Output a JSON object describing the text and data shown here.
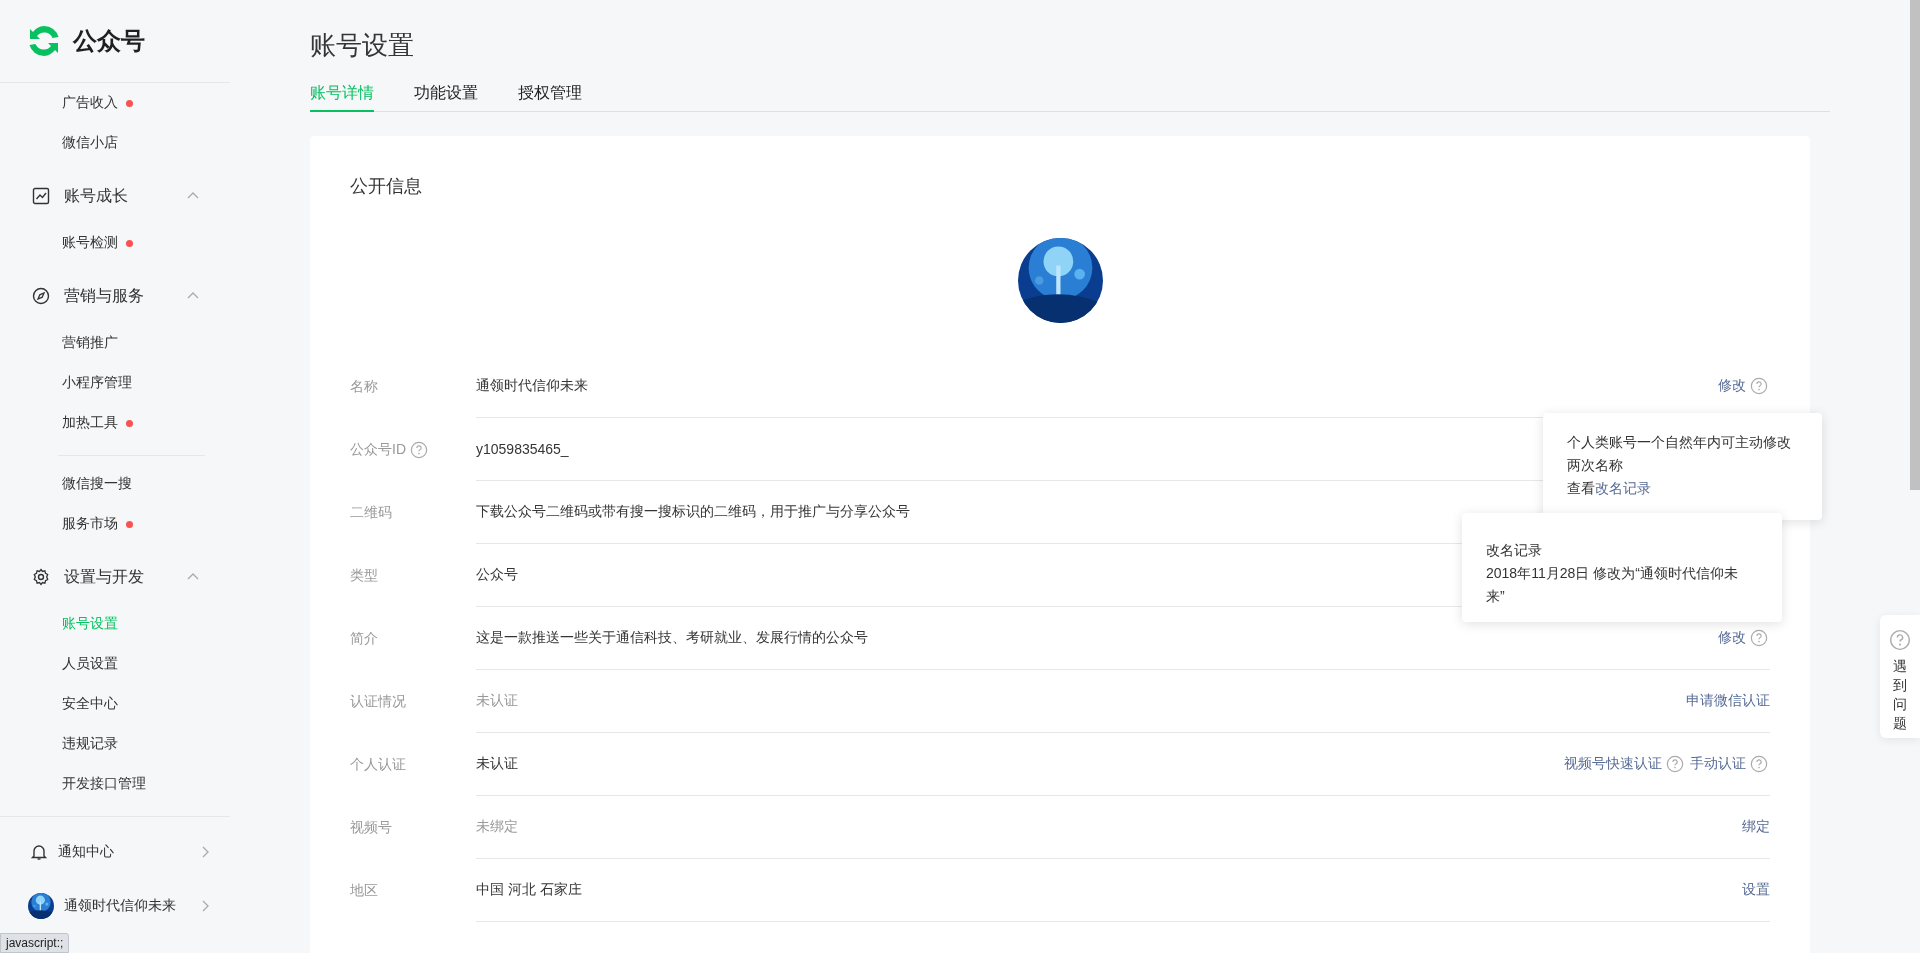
{
  "sidebar": {
    "logo_text": "公众号",
    "sections": [
      {
        "items": [
          {
            "kind": "link",
            "label": "广告收入",
            "badge": true,
            "selected": false
          },
          {
            "kind": "link",
            "label": "微信小店",
            "badge": false,
            "selected": false
          }
        ]
      },
      {
        "label": "账号成长",
        "expanded": true,
        "items": [
          {
            "kind": "link",
            "label": "账号检测",
            "badge": true,
            "selected": false
          }
        ]
      },
      {
        "label": "营销与服务",
        "expanded": true,
        "items": [
          {
            "kind": "link",
            "label": "营销推广",
            "badge": false,
            "selected": false
          },
          {
            "kind": "link",
            "label": "小程序管理",
            "badge": false,
            "selected": false
          },
          {
            "kind": "link",
            "label": "加热工具",
            "badge": true,
            "selected": false
          },
          {
            "kind": "separator"
          },
          {
            "kind": "link",
            "label": "微信搜一搜",
            "badge": false,
            "selected": false
          },
          {
            "kind": "link",
            "label": "服务市场",
            "badge": true,
            "selected": false
          }
        ]
      },
      {
        "label": "设置与开发",
        "expanded": true,
        "items": [
          {
            "kind": "link",
            "label": "账号设置",
            "badge": false,
            "selected": true
          },
          {
            "kind": "link",
            "label": "人员设置",
            "badge": false,
            "selected": false
          },
          {
            "kind": "link",
            "label": "安全中心",
            "badge": false,
            "selected": false
          },
          {
            "kind": "link",
            "label": "违规记录",
            "badge": false,
            "selected": false
          },
          {
            "kind": "link",
            "label": "开发接口管理",
            "badge": false,
            "selected": false
          }
        ]
      }
    ],
    "footer": [
      {
        "kind": "notice",
        "label": "通知中心"
      },
      {
        "kind": "account",
        "label": "通领时代信仰未来"
      }
    ]
  },
  "page_title": "账号设置",
  "tabs": [
    {
      "label": "账号详情",
      "selected": true
    },
    {
      "label": "功能设置",
      "selected": false
    },
    {
      "label": "授权管理",
      "selected": false
    }
  ],
  "card": {
    "title": "公开信息",
    "rows": [
      {
        "label": "名称",
        "label_help": false,
        "value": "通领时代信仰未来",
        "value_muted": false,
        "actions": [
          {
            "label": "修改",
            "help": true
          }
        ]
      },
      {
        "label": "公众号ID",
        "label_help": true,
        "value": "y1059835465_",
        "value_muted": false,
        "actions": []
      },
      {
        "label": "二维码",
        "label_help": false,
        "value": "下载公众号二维码或带有搜一搜标识的二维码，用于推广与分享公众号",
        "value_muted": false,
        "actions": []
      },
      {
        "label": "类型",
        "label_help": false,
        "value": "公众号",
        "value_muted": false,
        "actions": []
      },
      {
        "label": "简介",
        "label_help": false,
        "value": "这是一款推送一些关于通信科技、考研就业、发展行情的公众号",
        "value_muted": false,
        "actions": [
          {
            "label": "修改",
            "help": true
          }
        ]
      },
      {
        "label": "认证情况",
        "label_help": false,
        "value": "未认证",
        "value_muted": true,
        "actions": [
          {
            "label": "申请微信认证",
            "help": false
          }
        ]
      },
      {
        "label": "个人认证",
        "label_help": false,
        "value": "未认证",
        "value_muted": false,
        "actions": [
          {
            "label": "视频号快速认证",
            "help": true
          },
          {
            "label": "手动认证",
            "help": true
          }
        ]
      },
      {
        "label": "视频号",
        "label_help": false,
        "value": "未绑定",
        "value_muted": true,
        "actions": [
          {
            "label": "绑定",
            "help": false
          }
        ]
      },
      {
        "label": "地区",
        "label_help": false,
        "value": "中国 河北 石家庄",
        "value_muted": false,
        "actions": [
          {
            "label": "设置",
            "help": false
          }
        ]
      }
    ]
  },
  "tooltips": [
    {
      "text": "个人类账号一个自然年内可主动修改两次名称",
      "prefix": "查看",
      "link": "改名记录"
    },
    {
      "title": "改名记录",
      "text": "2018年11月28日 修改为“通领时代信仰未来”"
    }
  ],
  "help_button": {
    "label": "遇到问题"
  },
  "status_bar": "javascript:;"
}
